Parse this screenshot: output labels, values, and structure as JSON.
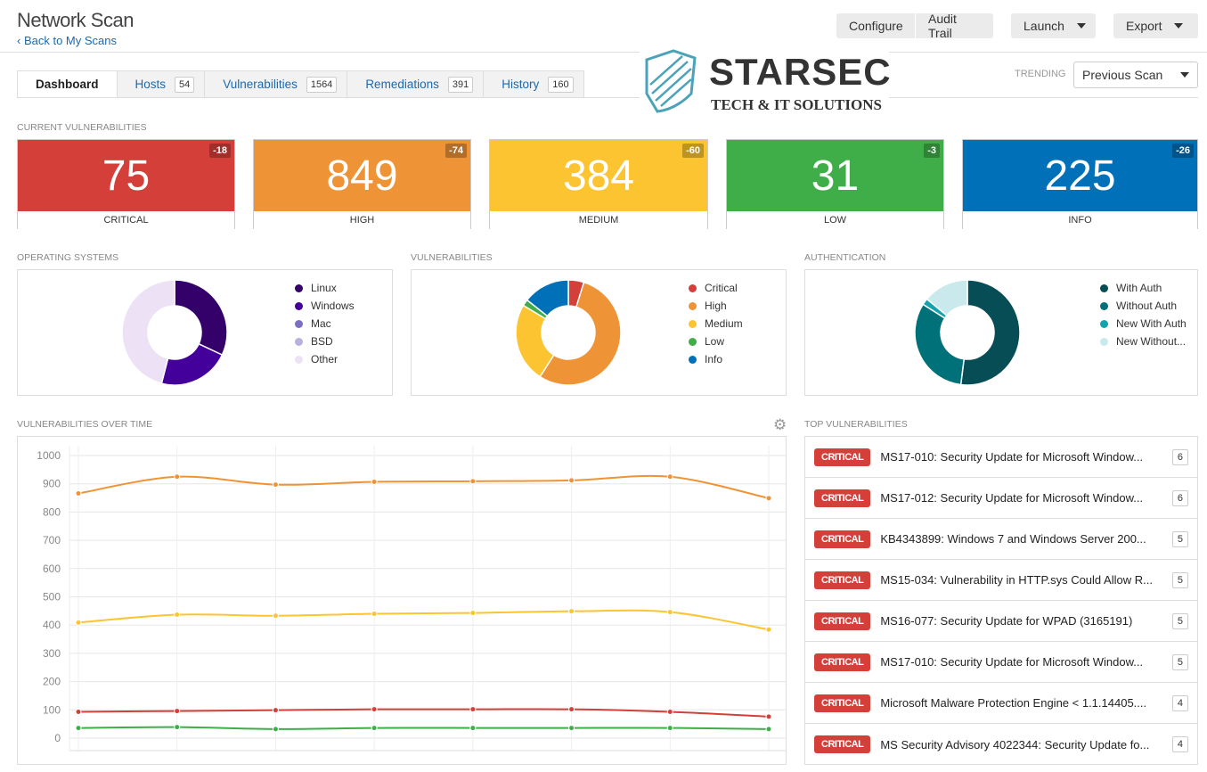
{
  "header": {
    "title": "Network Scan",
    "back_link": "Back to My Scans",
    "buttons": {
      "configure": "Configure",
      "audit_trail": "Audit Trail",
      "launch": "Launch",
      "export": "Export"
    }
  },
  "tabs": [
    {
      "label": "Dashboard",
      "active": true
    },
    {
      "label": "Hosts",
      "count": "54"
    },
    {
      "label": "Vulnerabilities",
      "count": "1564"
    },
    {
      "label": "Remediations",
      "count": "391"
    },
    {
      "label": "History",
      "count": "160"
    }
  ],
  "logo": {
    "name": "STARSEC",
    "tagline": "TECH & IT SOLUTIONS"
  },
  "trending": {
    "label": "TRENDING",
    "selected": "Previous Scan"
  },
  "current": {
    "title": "CURRENT VULNERABILITIES",
    "cards": [
      {
        "label": "CRITICAL",
        "value": "75",
        "delta": "-18",
        "color": "#d43f3a"
      },
      {
        "label": "HIGH",
        "value": "849",
        "delta": "-74",
        "color": "#ee9336"
      },
      {
        "label": "MEDIUM",
        "value": "384",
        "delta": "-60",
        "color": "#fdc431"
      },
      {
        "label": "LOW",
        "value": "31",
        "delta": "-3",
        "color": "#3fae49"
      },
      {
        "label": "INFO",
        "value": "225",
        "delta": "-26",
        "color": "#0071b9"
      }
    ]
  },
  "chart_data": [
    {
      "type": "pie",
      "title": "OPERATING SYSTEMS",
      "donut": true,
      "unit": "percent",
      "labels": [
        "Linux",
        "Windows",
        "Mac",
        "BSD",
        "Other"
      ],
      "values": [
        32,
        22,
        0,
        0,
        46
      ],
      "colors": [
        "#34006a",
        "#44009a",
        "#7b6fc4",
        "#b7b1dd",
        "#ece1f5"
      ]
    },
    {
      "type": "pie",
      "title": "VULNERABILITIES",
      "donut": true,
      "labels": [
        "Critical",
        "High",
        "Medium",
        "Low",
        "Info"
      ],
      "values": [
        75,
        849,
        384,
        31,
        225
      ],
      "colors": [
        "#d43f3a",
        "#ee9336",
        "#fdc431",
        "#3fae49",
        "#0071b9"
      ]
    },
    {
      "type": "pie",
      "title": "AUTHENTICATION",
      "donut": true,
      "unit": "percent",
      "labels": [
        "With Auth",
        "Without Auth",
        "New With Auth",
        "New Without..."
      ],
      "values": [
        52,
        32,
        2,
        14
      ],
      "colors": [
        "#074d55",
        "#007179",
        "#14a3ad",
        "#c9e9ed"
      ]
    },
    {
      "type": "line",
      "title": "VULNERABILITIES OVER TIME",
      "ylim": [
        0,
        1000
      ],
      "yticks": [
        0,
        100,
        200,
        300,
        400,
        500,
        600,
        700,
        800,
        900,
        1000
      ],
      "grid": true,
      "series": [
        {
          "color": "#ee9336",
          "values": [
            866,
            925,
            897,
            907,
            909,
            912,
            925,
            849
          ]
        },
        {
          "color": "#fdc431",
          "values": [
            409,
            437,
            433,
            440,
            443,
            449,
            446,
            384
          ]
        },
        {
          "color": "#d43f3a",
          "values": [
            93,
            96,
            99,
            102,
            102,
            102,
            93,
            76
          ]
        },
        {
          "color": "#3fae49",
          "values": [
            36,
            39,
            32,
            36,
            36,
            36,
            36,
            32
          ]
        }
      ]
    }
  ],
  "top_vulns": {
    "title": "TOP VULNERABILITIES",
    "items": [
      {
        "severity": "CRITICAL",
        "name": "MS17-010: Security Update for Microsoft Window...",
        "count": "6"
      },
      {
        "severity": "CRITICAL",
        "name": "MS17-012: Security Update for Microsoft Window...",
        "count": "6"
      },
      {
        "severity": "CRITICAL",
        "name": "KB4343899: Windows 7 and Windows Server 200...",
        "count": "5"
      },
      {
        "severity": "CRITICAL",
        "name": "MS15-034: Vulnerability in HTTP.sys Could Allow R...",
        "count": "5"
      },
      {
        "severity": "CRITICAL",
        "name": "MS16-077: Security Update for WPAD (3165191)",
        "count": "5"
      },
      {
        "severity": "CRITICAL",
        "name": "MS17-010: Security Update for Microsoft Window...",
        "count": "5"
      },
      {
        "severity": "CRITICAL",
        "name": "Microsoft Malware Protection Engine < 1.1.14405....",
        "count": "4"
      },
      {
        "severity": "CRITICAL",
        "name": "MS Security Advisory 4022344: Security Update fo...",
        "count": "4"
      }
    ]
  },
  "icons": {
    "back": "chevron-left-icon",
    "settings": "gear-icon",
    "dropdown": "caret-down-icon"
  }
}
